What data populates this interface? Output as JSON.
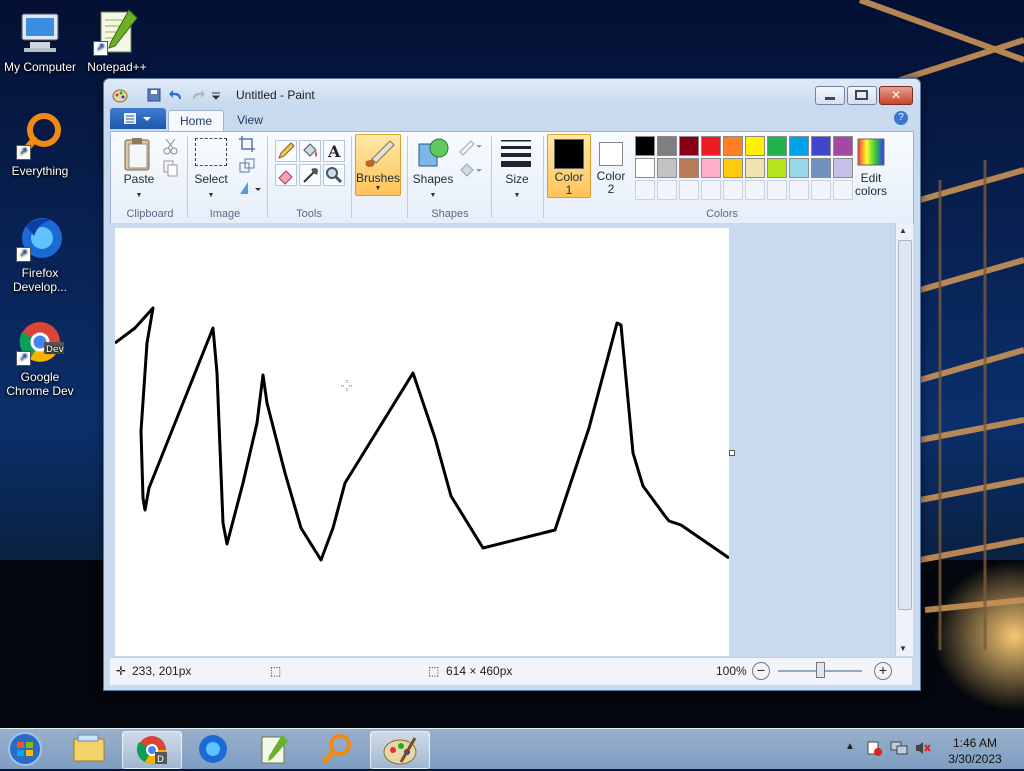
{
  "desktop": {
    "icons": [
      {
        "label": "My Computer",
        "icon": "computer-icon"
      },
      {
        "label": "Notepad++",
        "icon": "notepadpp-icon"
      },
      {
        "label": "Everything",
        "icon": "everything-icon"
      },
      {
        "label": "Firefox\nDevelop...",
        "icon": "firefox-developer-icon"
      },
      {
        "label": "Google\nChrome Dev",
        "icon": "chrome-dev-icon"
      }
    ]
  },
  "window": {
    "title": "Untitled - Paint",
    "tabs": [
      {
        "label": "Home"
      },
      {
        "label": "View"
      }
    ],
    "ribbon": {
      "clipboard": {
        "label": "Clipboard",
        "paste": "Paste"
      },
      "image": {
        "label": "Image",
        "select": "Select"
      },
      "tools": {
        "label": "Tools"
      },
      "brushes": {
        "label": "Brushes"
      },
      "shapes": {
        "label": "Shapes",
        "button": "Shapes"
      },
      "size": {
        "label": "Size"
      },
      "colors": {
        "label": "Colors",
        "color1": "Color\n1",
        "color2": "Color\n2",
        "edit": "Edit\ncolors",
        "color1_value": "#000000",
        "color2_value": "#ffffff",
        "palette_row1": [
          "#000000",
          "#7f7f7f",
          "#880015",
          "#ed1c24",
          "#ff7f27",
          "#fff200",
          "#22b14c",
          "#00a2e8",
          "#3f48cc",
          "#a349a4"
        ],
        "palette_row2": [
          "#ffffff",
          "#c3c3c3",
          "#b97a57",
          "#ffaec9",
          "#ffc90e",
          "#efe4b0",
          "#b5e61d",
          "#99d9ea",
          "#7092be",
          "#c8bfe7"
        ]
      }
    },
    "status": {
      "cursor_pos": "233, 201px",
      "canvas_size": "614 × 460px",
      "zoom": "100%"
    }
  },
  "taskbar": {
    "time": "1:46 AM",
    "date": "3/30/2023",
    "apps": [
      "start-orb-icon",
      "explorer-icon",
      "chrome-dev-icon",
      "firefox-icon",
      "notepadpp-icon",
      "everything-icon",
      "paint-icon"
    ]
  }
}
